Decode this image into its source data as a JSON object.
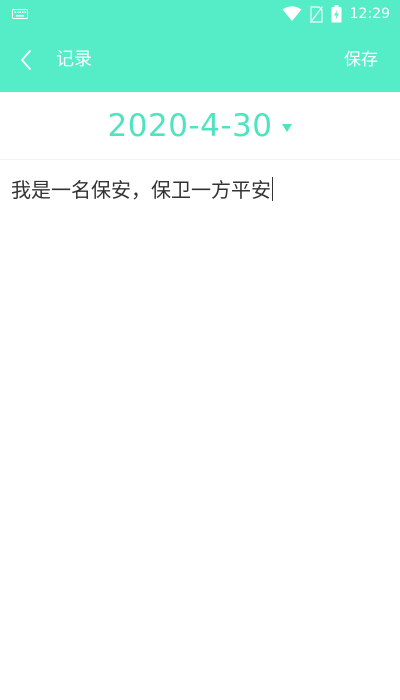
{
  "status_bar": {
    "time": "12:29",
    "icons": [
      "keyboard-icon",
      "wifi-icon",
      "no-sim-icon",
      "battery-charging-icon"
    ]
  },
  "toolbar": {
    "back_icon": "chevron-left-icon",
    "title": "记录",
    "save_label": "保存"
  },
  "date_picker": {
    "value": "2020-4-30",
    "arrow_icon": "triangle-down-icon"
  },
  "editor": {
    "text": "我是一名保安，保卫一方平安"
  },
  "colors": {
    "accent": "#55ecc8",
    "date_text": "#4fe3c0",
    "body_text": "#333333"
  }
}
